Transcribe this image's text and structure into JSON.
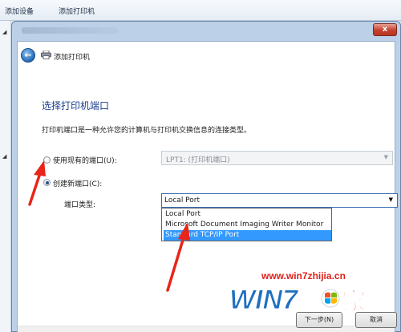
{
  "background": {
    "toolbar_items": [
      "添加设备",
      "添加打印机"
    ]
  },
  "window": {
    "title": "添加打印机",
    "close_symbol": "x"
  },
  "wizard": {
    "heading": "选择打印机端口",
    "description": "打印机端口是一种允许您的计算机与打印机交换信息的连接类型。",
    "existing_port_label": "使用现有的端口(U):",
    "existing_port_value": "LPT1: (打印机端口)",
    "existing_port_checked": false,
    "new_port_label": "创建新端口(C):",
    "new_port_checked": true,
    "port_type_label": "端口类型:",
    "port_type_value": "Local Port",
    "port_type_options": [
      "Local Port",
      "Microsoft Document Imaging Writer Monitor",
      "Standard TCP/IP Port"
    ],
    "highlighted_option": "Standard TCP/IP Port"
  },
  "buttons": {
    "next": "下一步(N)",
    "cancel": "取消"
  },
  "watermark": {
    "url": "www.win7zhijia.cn",
    "logo_text": "WIN7",
    "logo_suffix": "家"
  },
  "colors": {
    "heading": "#1a3e8c",
    "selection": "#3399ff",
    "annotation_arrow": "#e8251a",
    "watermark": "#e0201a"
  }
}
